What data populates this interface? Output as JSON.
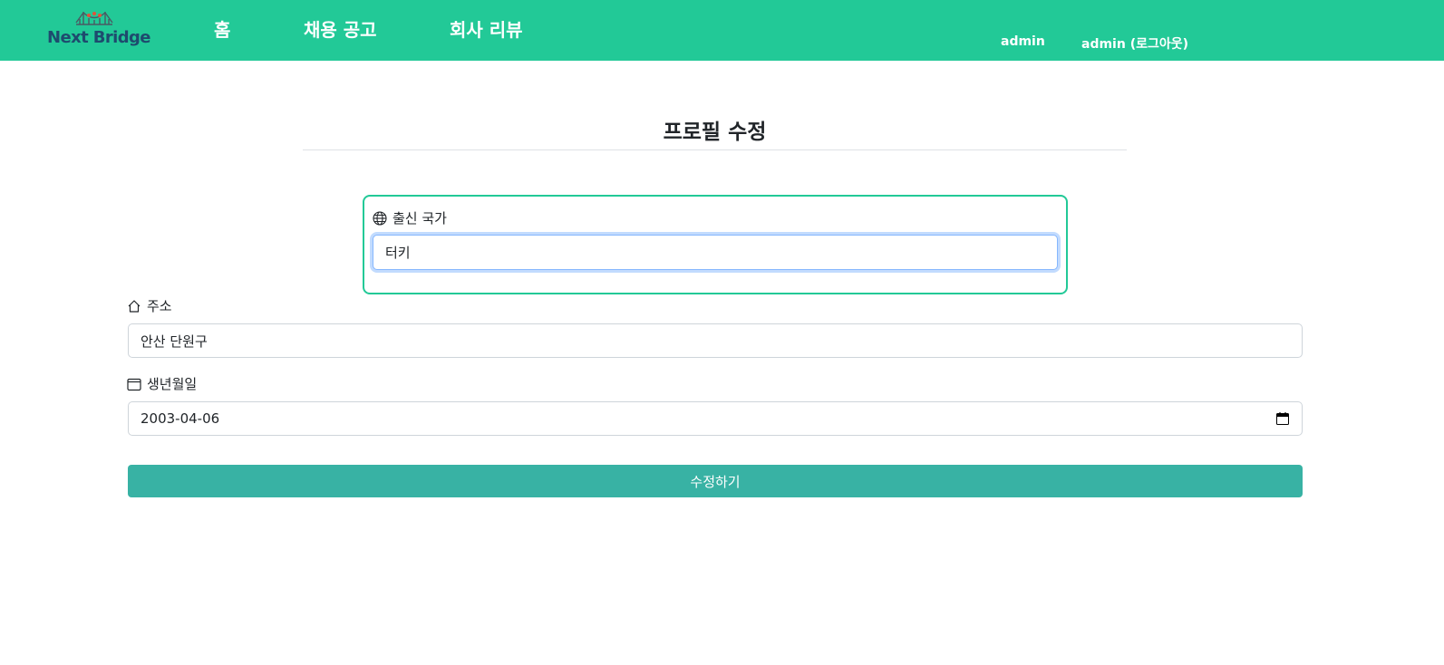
{
  "header": {
    "logo_text": "Next Bridge",
    "nav": {
      "home": "홈",
      "jobs": "채용 공고",
      "reviews": "회사 리뷰"
    },
    "user": {
      "username": "admin",
      "logout": "admin (로그아웃)"
    },
    "brand_color": "#22c997"
  },
  "page": {
    "title": "프로필 수정"
  },
  "form": {
    "country": {
      "icon": "globe-icon",
      "label": "출신 국가",
      "value": "터키"
    },
    "address": {
      "icon": "home-icon",
      "label": "주소",
      "value": "안산 단원구"
    },
    "birth_date": {
      "icon": "calendar-icon",
      "label": "생년월일",
      "value": "2003-04-06"
    },
    "submit_label": "수정하기",
    "submit_color": "#38b2a4"
  }
}
